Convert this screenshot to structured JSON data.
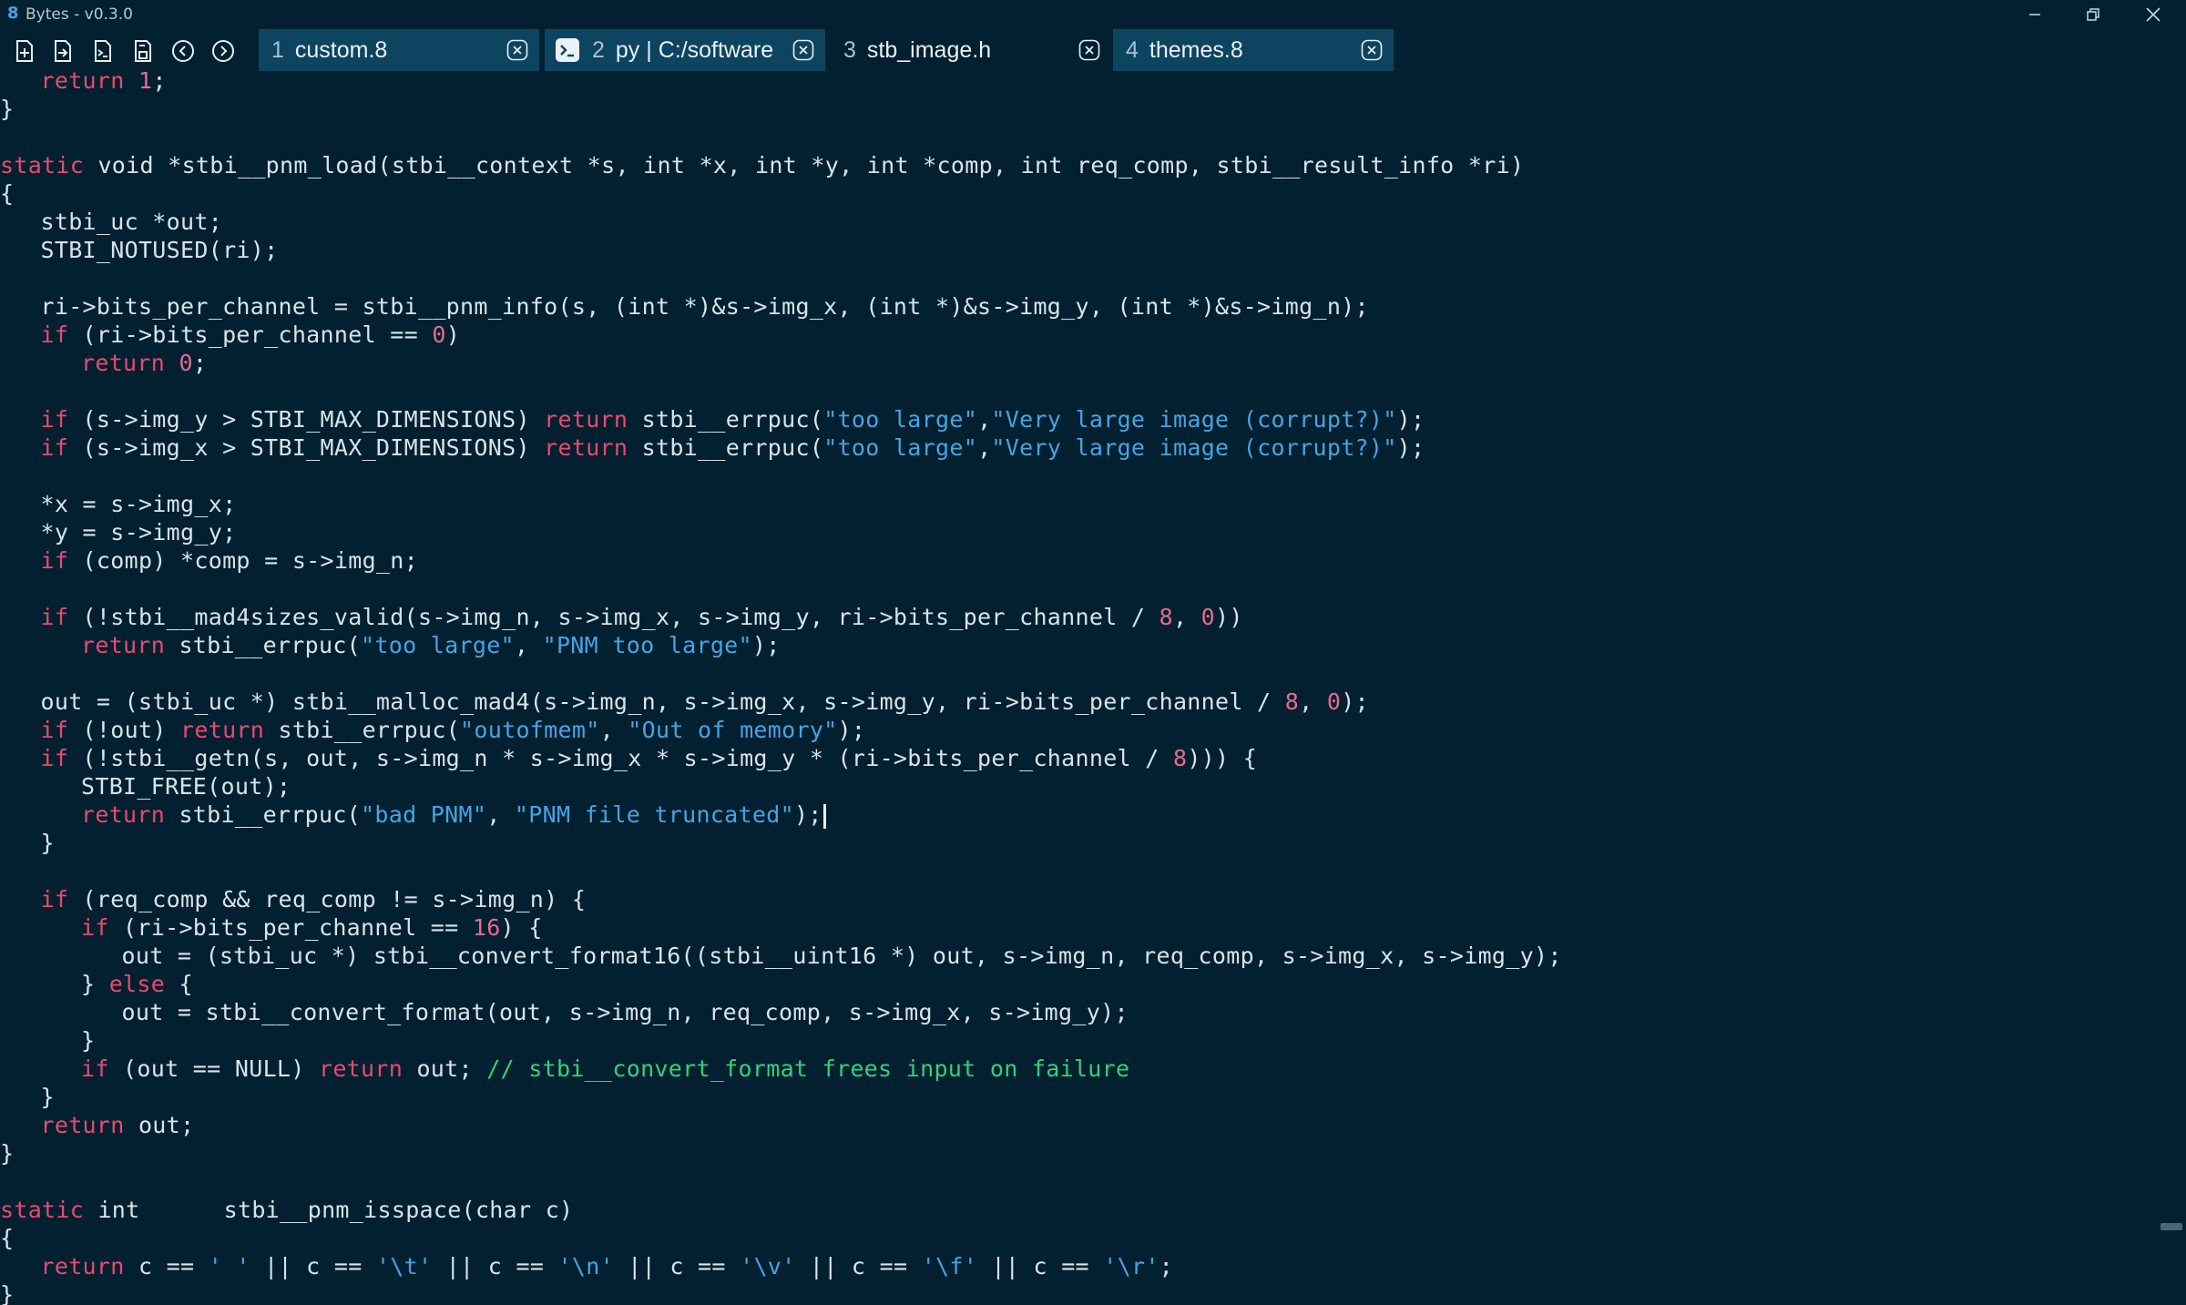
{
  "window": {
    "logo": "8",
    "title": "Bytes - v0.3.0"
  },
  "tabs": [
    {
      "num": "1",
      "label": "custom.8",
      "active": false
    },
    {
      "num": "2",
      "label": "py | C:/software",
      "active": false,
      "icon": "terminal-icon"
    },
    {
      "num": "3",
      "label": "stb_image.h",
      "active": true
    },
    {
      "num": "4",
      "label": "themes.8",
      "active": false
    }
  ],
  "toolbar": {
    "icons": [
      "new-file-icon",
      "open-file-icon",
      "new-terminal-icon",
      "save-icon",
      "back-icon",
      "forward-icon"
    ]
  },
  "colors": {
    "background": "#02202f",
    "tab_inactive": "#0d4460",
    "keyword": "#e84a6f",
    "string": "#46a4e6",
    "number": "#e56b8d",
    "comment": "#33d17a",
    "text": "#d8e3ea"
  },
  "editor": {
    "lines": [
      {
        "indent": 1,
        "tokens": [
          {
            "t": "kw",
            "v": "return"
          },
          {
            "t": "p",
            "v": " "
          },
          {
            "t": "num",
            "v": "1"
          },
          {
            "t": "p",
            "v": ";"
          }
        ]
      },
      {
        "indent": 0,
        "tokens": [
          {
            "t": "p",
            "v": "}"
          }
        ]
      },
      {
        "indent": 0,
        "tokens": []
      },
      {
        "indent": 0,
        "tokens": [
          {
            "t": "kw",
            "v": "static"
          },
          {
            "t": "p",
            "v": " void *stbi__pnm_load(stbi__context *s, int *x, int *y, int *comp, int req_comp, stbi__result_info *ri)"
          }
        ]
      },
      {
        "indent": 0,
        "tokens": [
          {
            "t": "p",
            "v": "{"
          }
        ]
      },
      {
        "indent": 1,
        "tokens": [
          {
            "t": "p",
            "v": "stbi_uc *out;"
          }
        ]
      },
      {
        "indent": 1,
        "tokens": [
          {
            "t": "p",
            "v": "STBI_NOTUSED(ri);"
          }
        ]
      },
      {
        "indent": 0,
        "tokens": []
      },
      {
        "indent": 1,
        "tokens": [
          {
            "t": "p",
            "v": "ri->bits_per_channel = stbi__pnm_info(s, (int *)&s->img_x, (int *)&s->img_y, (int *)&s->img_n);"
          }
        ]
      },
      {
        "indent": 1,
        "tokens": [
          {
            "t": "kw",
            "v": "if"
          },
          {
            "t": "p",
            "v": " (ri->bits_per_channel == "
          },
          {
            "t": "num",
            "v": "0"
          },
          {
            "t": "p",
            "v": ")"
          }
        ]
      },
      {
        "indent": 2,
        "tokens": [
          {
            "t": "kw",
            "v": "return"
          },
          {
            "t": "p",
            "v": " "
          },
          {
            "t": "num",
            "v": "0"
          },
          {
            "t": "p",
            "v": ";"
          }
        ]
      },
      {
        "indent": 0,
        "tokens": []
      },
      {
        "indent": 1,
        "tokens": [
          {
            "t": "kw",
            "v": "if"
          },
          {
            "t": "p",
            "v": " (s->img_y > STBI_MAX_DIMENSIONS) "
          },
          {
            "t": "kw",
            "v": "return"
          },
          {
            "t": "p",
            "v": " stbi__errpuc("
          },
          {
            "t": "str",
            "v": "\"too large\""
          },
          {
            "t": "p",
            "v": ","
          },
          {
            "t": "str",
            "v": "\"Very large image (corrupt?)\""
          },
          {
            "t": "p",
            "v": ");"
          }
        ]
      },
      {
        "indent": 1,
        "tokens": [
          {
            "t": "kw",
            "v": "if"
          },
          {
            "t": "p",
            "v": " (s->img_x > STBI_MAX_DIMENSIONS) "
          },
          {
            "t": "kw",
            "v": "return"
          },
          {
            "t": "p",
            "v": " stbi__errpuc("
          },
          {
            "t": "str",
            "v": "\"too large\""
          },
          {
            "t": "p",
            "v": ","
          },
          {
            "t": "str",
            "v": "\"Very large image (corrupt?)\""
          },
          {
            "t": "p",
            "v": ");"
          }
        ]
      },
      {
        "indent": 0,
        "tokens": []
      },
      {
        "indent": 1,
        "tokens": [
          {
            "t": "p",
            "v": "*x = s->img_x;"
          }
        ]
      },
      {
        "indent": 1,
        "tokens": [
          {
            "t": "p",
            "v": "*y = s->img_y;"
          }
        ]
      },
      {
        "indent": 1,
        "tokens": [
          {
            "t": "kw",
            "v": "if"
          },
          {
            "t": "p",
            "v": " (comp) *comp = s->img_n;"
          }
        ]
      },
      {
        "indent": 0,
        "tokens": []
      },
      {
        "indent": 1,
        "tokens": [
          {
            "t": "kw",
            "v": "if"
          },
          {
            "t": "p",
            "v": " (!stbi__mad4sizes_valid(s->img_n, s->img_x, s->img_y, ri->bits_per_channel / "
          },
          {
            "t": "num",
            "v": "8"
          },
          {
            "t": "p",
            "v": ", "
          },
          {
            "t": "num",
            "v": "0"
          },
          {
            "t": "p",
            "v": "))"
          }
        ]
      },
      {
        "indent": 2,
        "tokens": [
          {
            "t": "kw",
            "v": "return"
          },
          {
            "t": "p",
            "v": " stbi__errpuc("
          },
          {
            "t": "str",
            "v": "\"too large\""
          },
          {
            "t": "p",
            "v": ", "
          },
          {
            "t": "str",
            "v": "\"PNM too large\""
          },
          {
            "t": "p",
            "v": ");"
          }
        ]
      },
      {
        "indent": 0,
        "tokens": []
      },
      {
        "indent": 1,
        "tokens": [
          {
            "t": "p",
            "v": "out = (stbi_uc *) stbi__malloc_mad4(s->img_n, s->img_x, s->img_y, ri->bits_per_channel / "
          },
          {
            "t": "num",
            "v": "8"
          },
          {
            "t": "p",
            "v": ", "
          },
          {
            "t": "num",
            "v": "0"
          },
          {
            "t": "p",
            "v": ");"
          }
        ]
      },
      {
        "indent": 1,
        "tokens": [
          {
            "t": "kw",
            "v": "if"
          },
          {
            "t": "p",
            "v": " (!out) "
          },
          {
            "t": "kw",
            "v": "return"
          },
          {
            "t": "p",
            "v": " stbi__errpuc("
          },
          {
            "t": "str",
            "v": "\"outofmem\""
          },
          {
            "t": "p",
            "v": ", "
          },
          {
            "t": "str",
            "v": "\"Out of memory\""
          },
          {
            "t": "p",
            "v": ");"
          }
        ]
      },
      {
        "indent": 1,
        "tokens": [
          {
            "t": "kw",
            "v": "if"
          },
          {
            "t": "p",
            "v": " (!stbi__getn(s, out, s->img_n * s->img_x * s->img_y * (ri->bits_per_channel / "
          },
          {
            "t": "num",
            "v": "8"
          },
          {
            "t": "p",
            "v": "))) {"
          }
        ]
      },
      {
        "indent": 2,
        "tokens": [
          {
            "t": "p",
            "v": "STBI_FREE(out);"
          }
        ]
      },
      {
        "indent": 2,
        "cursor": true,
        "tokens": [
          {
            "t": "kw",
            "v": "return"
          },
          {
            "t": "p",
            "v": " stbi__errpuc("
          },
          {
            "t": "str",
            "v": "\"bad PNM\""
          },
          {
            "t": "p",
            "v": ", "
          },
          {
            "t": "str",
            "v": "\"PNM file truncated\""
          },
          {
            "t": "p",
            "v": ");"
          }
        ]
      },
      {
        "indent": 1,
        "tokens": [
          {
            "t": "p",
            "v": "}"
          }
        ]
      },
      {
        "indent": 0,
        "tokens": []
      },
      {
        "indent": 1,
        "tokens": [
          {
            "t": "kw",
            "v": "if"
          },
          {
            "t": "p",
            "v": " (req_comp && req_comp != s->img_n) {"
          }
        ]
      },
      {
        "indent": 2,
        "tokens": [
          {
            "t": "kw",
            "v": "if"
          },
          {
            "t": "p",
            "v": " (ri->bits_per_channel == "
          },
          {
            "t": "num",
            "v": "16"
          },
          {
            "t": "p",
            "v": ") {"
          }
        ]
      },
      {
        "indent": 3,
        "tokens": [
          {
            "t": "p",
            "v": "out = (stbi_uc *) stbi__convert_format16((stbi__uint16 *) out, s->img_n, req_comp, s->img_x, s->img_y);"
          }
        ]
      },
      {
        "indent": 2,
        "tokens": [
          {
            "t": "p",
            "v": "} "
          },
          {
            "t": "kw",
            "v": "else"
          },
          {
            "t": "p",
            "v": " {"
          }
        ]
      },
      {
        "indent": 3,
        "tokens": [
          {
            "t": "p",
            "v": "out = stbi__convert_format(out, s->img_n, req_comp, s->img_x, s->img_y);"
          }
        ]
      },
      {
        "indent": 2,
        "tokens": [
          {
            "t": "p",
            "v": "}"
          }
        ]
      },
      {
        "indent": 2,
        "tokens": [
          {
            "t": "kw",
            "v": "if"
          },
          {
            "t": "p",
            "v": " (out == NULL) "
          },
          {
            "t": "kw",
            "v": "return"
          },
          {
            "t": "p",
            "v": " out; "
          },
          {
            "t": "com",
            "v": "// stbi__convert_format frees input on failure"
          }
        ]
      },
      {
        "indent": 1,
        "tokens": [
          {
            "t": "p",
            "v": "}"
          }
        ]
      },
      {
        "indent": 1,
        "tokens": [
          {
            "t": "kw",
            "v": "return"
          },
          {
            "t": "p",
            "v": " out;"
          }
        ]
      },
      {
        "indent": 0,
        "tokens": [
          {
            "t": "p",
            "v": "}"
          }
        ]
      },
      {
        "indent": 0,
        "tokens": []
      },
      {
        "indent": 0,
        "tokens": [
          {
            "t": "kw",
            "v": "static"
          },
          {
            "t": "p",
            "v": " int      stbi__pnm_isspace(char c)"
          }
        ]
      },
      {
        "indent": 0,
        "tokens": [
          {
            "t": "p",
            "v": "{"
          }
        ]
      },
      {
        "indent": 1,
        "tokens": [
          {
            "t": "kw",
            "v": "return"
          },
          {
            "t": "p",
            "v": " c == "
          },
          {
            "t": "str",
            "v": "' '"
          },
          {
            "t": "p",
            "v": " || c == "
          },
          {
            "t": "str",
            "v": "'\\t'"
          },
          {
            "t": "p",
            "v": " || c == "
          },
          {
            "t": "str",
            "v": "'\\n'"
          },
          {
            "t": "p",
            "v": " || c == "
          },
          {
            "t": "str",
            "v": "'\\v'"
          },
          {
            "t": "p",
            "v": " || c == "
          },
          {
            "t": "str",
            "v": "'\\f'"
          },
          {
            "t": "p",
            "v": " || c == "
          },
          {
            "t": "str",
            "v": "'\\r'"
          },
          {
            "t": "p",
            "v": ";"
          }
        ]
      },
      {
        "indent": 0,
        "tokens": [
          {
            "t": "p",
            "v": "}"
          }
        ]
      }
    ]
  }
}
